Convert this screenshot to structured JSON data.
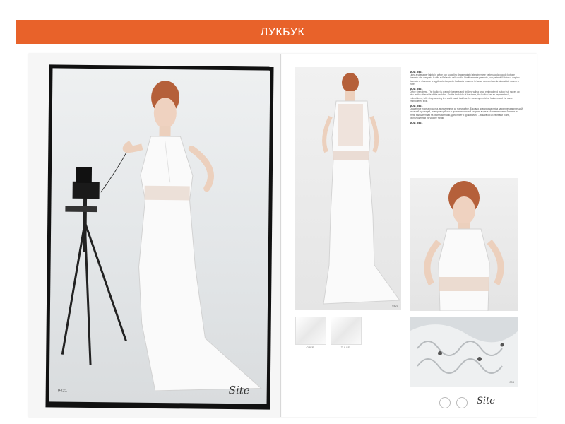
{
  "banner": {
    "title": "ЛУКБУК"
  },
  "main_photo": {
    "code": "9421",
    "signature": "Site"
  },
  "back_photo": {
    "code": "9421"
  },
  "text_block": {
    "sections": [
      {
        "heading": "MOD. 9421",
        "body": "Linea a sirena per l'abito in crêpe con scapolino drappeggiato lateralmente e trattenuto da piccolo bottone ricamato che completa lo stile sull'allaccio dello scollo. Positivamente presente, una parte dell'abito sul corpino ricamato a rilievo con le applicazioni a punto. La fascia presente in basso scomenica e la sinuosità è ricamo a volte."
      },
      {
        "heading": "MOD. 9421",
        "body": "Crêpe siren dress. The bodice is draped sideways and finished with a small embroidered button that moves up also on the other side of the neckline. On the backside of the dress, the bodice has an asymmetrical, embroidered, tulle strap tapering to a waist band, that has the same symmetrical features and the same embroidered style."
      },
      {
        "heading": "MOD. 9421",
        "body": "Свадебное платье русалка, выполненное из ткани crêpe. Боковая драпировка лифа закреплена маленькой вышитой пуговицей, повторяющейся и в противоположной стороне выреза. Асимметричная бретель из тюля, выполненная на ресницах ткани, дополняет и драматично ...вышивкой из тюлевой ткани, расположенной на уровне талии."
      },
      {
        "heading": "MOD. 9421",
        "body": "..."
      }
    ]
  },
  "swatches": [
    {
      "label": "CREP"
    },
    {
      "label": "TULLE"
    }
  ],
  "detail_photo": {
    "code": "003"
  },
  "footer": {
    "signature": "Site"
  }
}
